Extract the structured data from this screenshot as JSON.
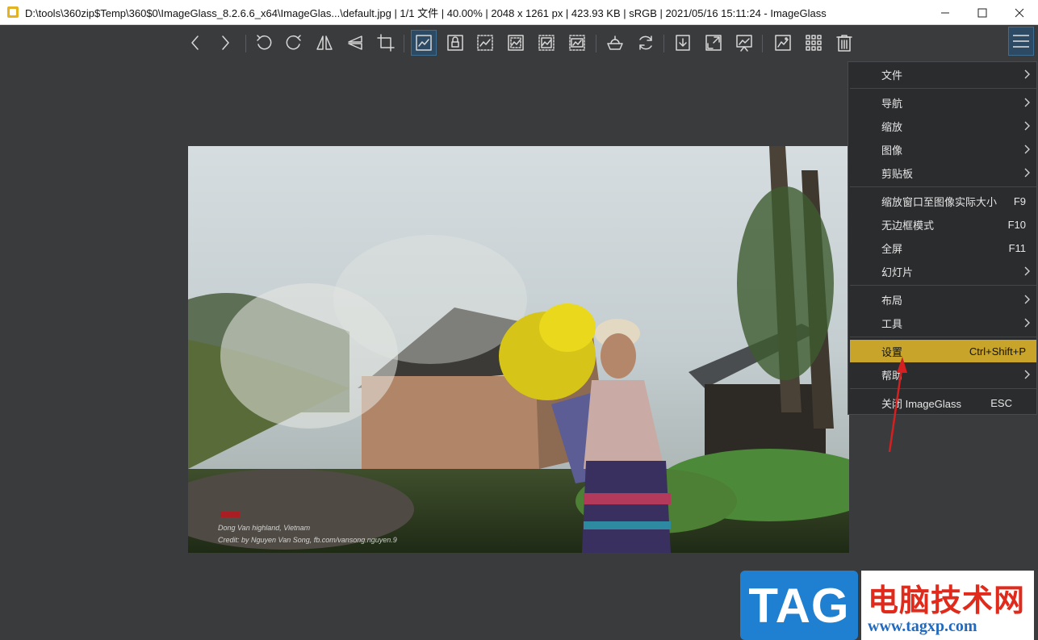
{
  "window": {
    "title": "D:\\tools\\360zip$Temp\\360$0\\ImageGlass_8.2.6.6_x64\\ImageGlas...\\default.jpg  |  1/1 文件  |  40.00%  |  2048 x 1261 px  |  423.93 KB  |  sRGB  |  2021/05/16 15:11:24  - ImageGlass",
    "min_icon": "minimize-icon",
    "max_icon": "maximize-icon",
    "close_icon": "close-icon"
  },
  "toolbar": {
    "buttons": [
      "previous-image",
      "next-image",
      "rotate-left",
      "rotate-right",
      "flip-horizontal",
      "flip-vertical",
      "crop",
      "auto-zoom",
      "lock-zoom",
      "scale-to-width",
      "scale-to-height",
      "scale-to-fit",
      "scale-to-fill",
      "color-picker",
      "refresh",
      "open-file",
      "view-fullscreen",
      "slideshow",
      "set-wallpaper",
      "thumbnail-bar",
      "delete"
    ],
    "active_button": "auto-zoom",
    "accent_color": "#2c4a63"
  },
  "image": {
    "caption_line1": "Dong Van highland, Vietnam",
    "caption_line2": "Credit: by Nguyen Van Song, fb.com/vansong.nguyen.9"
  },
  "context_menu": {
    "items": [
      {
        "label": "文件",
        "shortcut": "",
        "submenu": true
      },
      {
        "label": "导航",
        "shortcut": "",
        "submenu": true
      },
      {
        "label": "缩放",
        "shortcut": "",
        "submenu": true
      },
      {
        "label": "图像",
        "shortcut": "",
        "submenu": true
      },
      {
        "label": "剪贴板",
        "shortcut": "",
        "submenu": true
      },
      {
        "label": "缩放窗口至图像实际大小",
        "shortcut": "F9",
        "submenu": false
      },
      {
        "label": "无边框模式",
        "shortcut": "F10",
        "submenu": false
      },
      {
        "label": "全屏",
        "shortcut": "F11",
        "submenu": false
      },
      {
        "label": "幻灯片",
        "shortcut": "",
        "submenu": true
      },
      {
        "label": "布局",
        "shortcut": "",
        "submenu": true
      },
      {
        "label": "工具",
        "shortcut": "",
        "submenu": true
      },
      {
        "label": "设置",
        "shortcut": "Ctrl+Shift+P",
        "submenu": false
      },
      {
        "label": "帮助",
        "shortcut": "",
        "submenu": true
      },
      {
        "label": "关闭 ImageGlass",
        "shortcut": "ESC",
        "submenu": false
      }
    ],
    "highlight_color": "#c8a52a"
  },
  "watermark": {
    "tag": "TAG",
    "title": "电脑技术网",
    "url": "www.tagxp.com"
  }
}
